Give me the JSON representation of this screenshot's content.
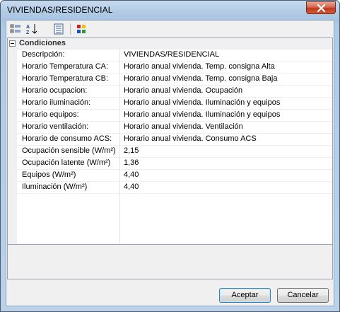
{
  "window": {
    "title": "VIVIENDAS/RESIDENCIAL"
  },
  "toolbar": {
    "buttons": [
      {
        "icon": "categorized-view-icon"
      },
      {
        "icon": "sort-alphabetical-icon"
      },
      {
        "icon": "property-pages-icon"
      },
      {
        "icon": "color-palette-icon"
      }
    ]
  },
  "grid": {
    "category": "Condiciones",
    "properties": [
      {
        "name": "Descripción:",
        "value": "VIVIENDAS/RESIDENCIAL"
      },
      {
        "name": "Horario Temperatura CA:",
        "value": "Horario anual vivienda. Temp. consigna Alta"
      },
      {
        "name": "Horario Temperatura CB:",
        "value": "Horario anual vivienda. Temp. consigna Baja"
      },
      {
        "name": "Horario ocupacion:",
        "value": "Horario anual vivienda. Ocupación"
      },
      {
        "name": "Horario iluminación:",
        "value": "Horario anual vivienda. Iluminación y equipos"
      },
      {
        "name": "Horario equipos:",
        "value": "Horario anual vivienda. Iluminación y equipos"
      },
      {
        "name": "Horario ventilación:",
        "value": "Horario anual vivienda. Ventilación"
      },
      {
        "name": "Horario de consumo ACS:",
        "value": "Horario anual vivienda. Consumo ACS"
      },
      {
        "name": "Ocupación sensible (W/m²)",
        "value": "2,15"
      },
      {
        "name": "Ocupación latente (W/m²)",
        "value": "1,36"
      },
      {
        "name": "Equipos (W/m²)",
        "value": "4,40"
      },
      {
        "name": "Iluminación (W/m²)",
        "value": "4,40"
      }
    ]
  },
  "buttons": {
    "accept": "Aceptar",
    "cancel": "Cancelar"
  }
}
